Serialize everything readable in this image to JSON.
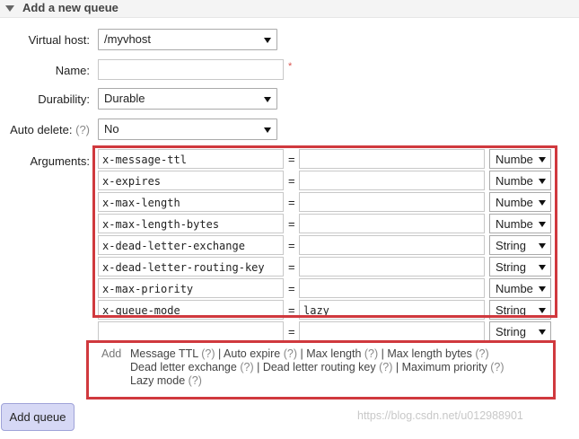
{
  "header": {
    "title": "Add a new queue"
  },
  "form": {
    "virtual_host_label": "Virtual host:",
    "virtual_host_value": "/myvhost",
    "name_label": "Name:",
    "name_value": "",
    "required_marker": "*",
    "durability_label": "Durability:",
    "durability_value": "Durable",
    "auto_delete_label": "Auto delete:",
    "auto_delete_help": "(?)",
    "auto_delete_value": "No",
    "arguments_label": "Arguments:",
    "equals": "="
  },
  "arguments": [
    {
      "key": "x-message-ttl",
      "value": "",
      "type": "Numbe"
    },
    {
      "key": "x-expires",
      "value": "",
      "type": "Numbe"
    },
    {
      "key": "x-max-length",
      "value": "",
      "type": "Numbe"
    },
    {
      "key": "x-max-length-bytes",
      "value": "",
      "type": "Numbe"
    },
    {
      "key": "x-dead-letter-exchange",
      "value": "",
      "type": "String"
    },
    {
      "key": "x-dead-letter-routing-key",
      "value": "",
      "type": "String"
    },
    {
      "key": "x-max-priority",
      "value": "",
      "type": "Numbe"
    },
    {
      "key": "x-queue-mode",
      "value": "lazy",
      "type": "String"
    },
    {
      "key": "",
      "value": "",
      "type": "String"
    }
  ],
  "add_links": {
    "add_label": "Add",
    "help": "(?)",
    "separator": "|",
    "items": [
      "Message TTL",
      "Auto expire",
      "Max length",
      "Max length bytes",
      "Dead letter exchange",
      "Dead letter routing key",
      "Maximum priority",
      "Lazy mode"
    ]
  },
  "button": {
    "label": "Add queue"
  },
  "watermark": "https://blog.csdn.net/u012988901",
  "colors": {
    "highlight_border": "#d0393e",
    "button_bg": "#d6d8f5"
  }
}
